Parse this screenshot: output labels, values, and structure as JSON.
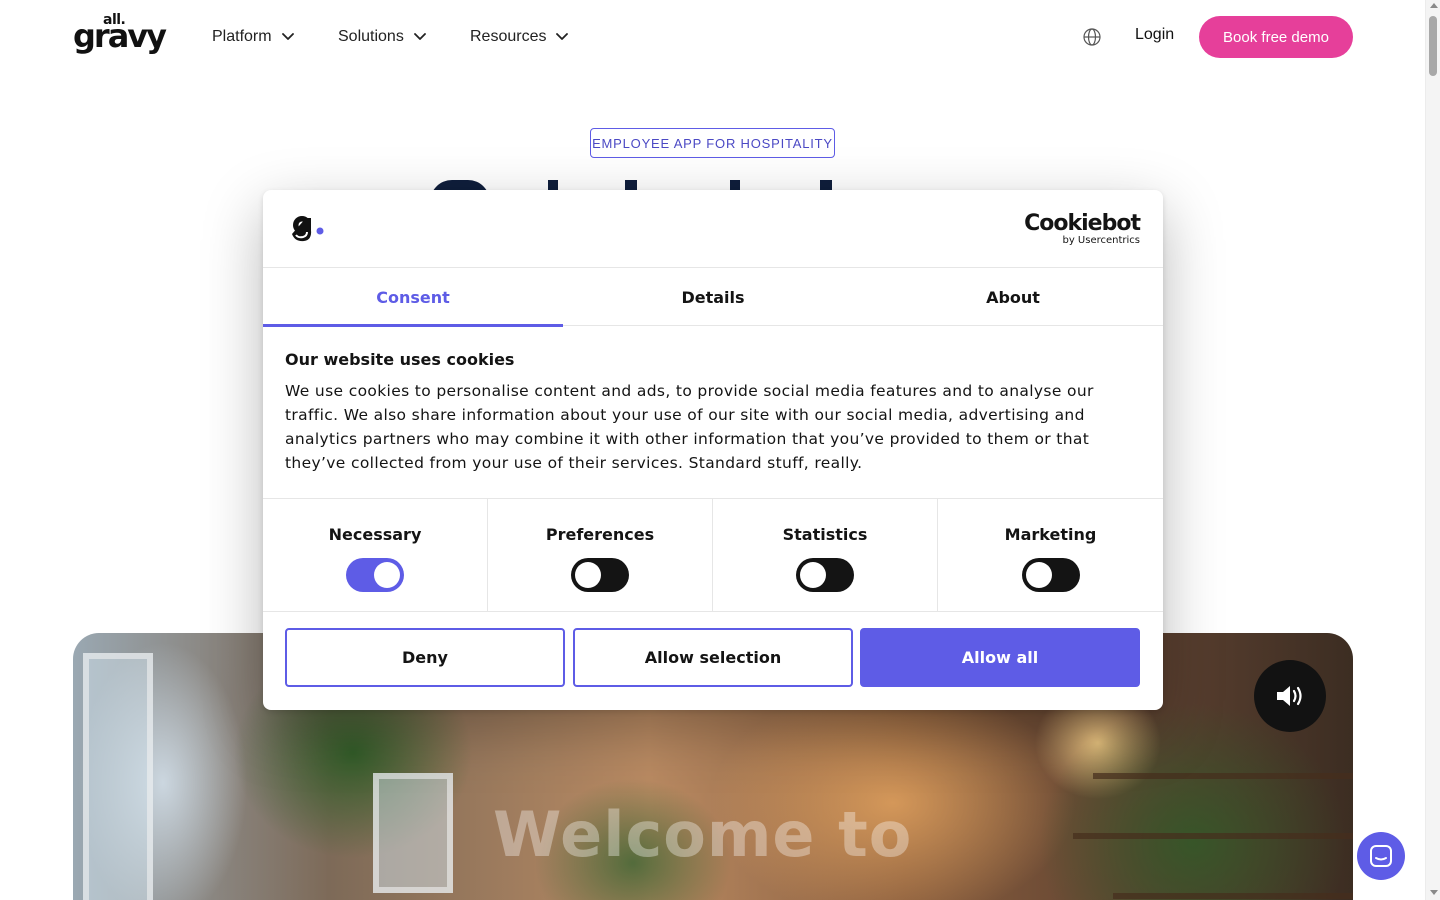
{
  "header": {
    "logo_small": "all.",
    "logo_big": "gravy",
    "nav": [
      {
        "label": "Platform"
      },
      {
        "label": "Solutions"
      },
      {
        "label": "Resources"
      }
    ],
    "login": "Login",
    "cta": "Book free demo"
  },
  "hero": {
    "eyebrow": "EMPLOYEE APP FOR HOSPITALITY",
    "video_overlay_text": "Welcome to"
  },
  "cookie_dialog": {
    "provider": "Cookiebot",
    "provider_sub": "by Usercentrics",
    "tabs": [
      {
        "label": "Consent",
        "active": true
      },
      {
        "label": "Details",
        "active": false
      },
      {
        "label": "About",
        "active": false
      }
    ],
    "title": "Our website uses cookies",
    "body": "We use cookies to personalise content and ads, to provide social media features and to analyse our traffic. We also share information about your use of our site with our social media, advertising and analytics partners who may combine it with other information that you’ve provided to them or that they’ve collected from your use of their services. Standard stuff, really.",
    "categories": [
      {
        "label": "Necessary",
        "enabled": true
      },
      {
        "label": "Preferences",
        "enabled": false
      },
      {
        "label": "Statistics",
        "enabled": false
      },
      {
        "label": "Marketing",
        "enabled": false
      }
    ],
    "buttons": {
      "deny": "Deny",
      "allow_selection": "Allow selection",
      "allow_all": "Allow all"
    }
  },
  "colors": {
    "accent": "#5e5ce6",
    "cta": "#e63f9a"
  }
}
